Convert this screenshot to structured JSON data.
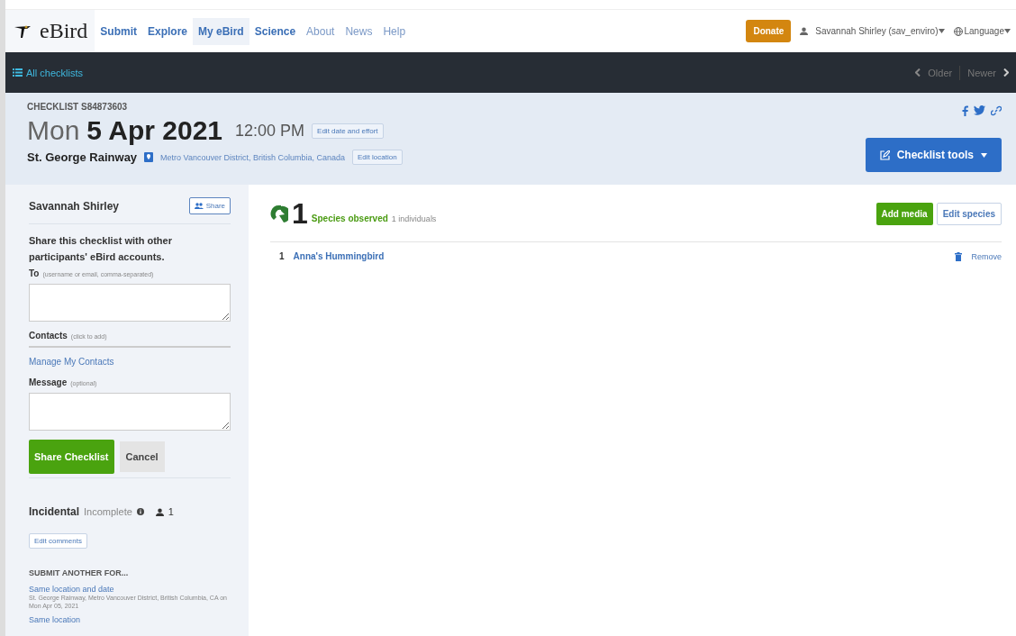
{
  "nav": {
    "logo": "eBird",
    "items": [
      {
        "label": "Submit",
        "kind": "primary",
        "selected": false
      },
      {
        "label": "Explore",
        "kind": "primary",
        "selected": false
      },
      {
        "label": "My eBird",
        "kind": "primary",
        "selected": true
      },
      {
        "label": "Science",
        "kind": "primary",
        "selected": false
      },
      {
        "label": "About",
        "kind": "secondary",
        "selected": false
      },
      {
        "label": "News",
        "kind": "secondary",
        "selected": false
      },
      {
        "label": "Help",
        "kind": "secondary",
        "selected": false
      }
    ],
    "donate": "Donate",
    "user": "Savannah Shirley (sav_enviro)",
    "language": "Language"
  },
  "subbar": {
    "all": "All checklists",
    "older": "Older",
    "newer": "Newer"
  },
  "header": {
    "checklist_id": "CHECKLIST S84873603",
    "weekday": "Mon",
    "date": "5 Apr 2021",
    "time": "12:00 PM",
    "edit_date": "Edit date and effort",
    "location": "St. George Rainway",
    "region": "Metro Vancouver District,  British Columbia,  Canada",
    "edit_location": "Edit location",
    "tools": "Checklist tools"
  },
  "sidebar": {
    "owner": "Savannah Shirley",
    "share": "Share",
    "intro": "Share this checklist with other participants' eBird accounts.",
    "to_label": "To",
    "to_hint": "(username or email, comma-separated)",
    "contacts_label": "Contacts",
    "contacts_hint": "(click to add)",
    "manage": "Manage My Contacts",
    "message_label": "Message",
    "message_hint": "(optional)",
    "share_button": "Share Checklist",
    "cancel": "Cancel",
    "protocol": "Incidental",
    "status": "Incomplete",
    "observers": "1",
    "edit_comments": "Edit comments",
    "submit_another": "SUBMIT ANOTHER FOR...",
    "same_loc_date": "Same location and date",
    "same_loc_date_detail": "St. George Rainway, Metro Vancouver District, British Columbia, CA on Mon Apr 05, 2021",
    "same_loc": "Same location"
  },
  "main": {
    "count": "1",
    "species_label": "Species observed",
    "individuals": "1 individuals",
    "add_media": "Add media",
    "edit_species": "Edit species",
    "species": [
      {
        "count": "1",
        "name": "Anna's Hummingbird",
        "remove": "Remove"
      }
    ]
  }
}
